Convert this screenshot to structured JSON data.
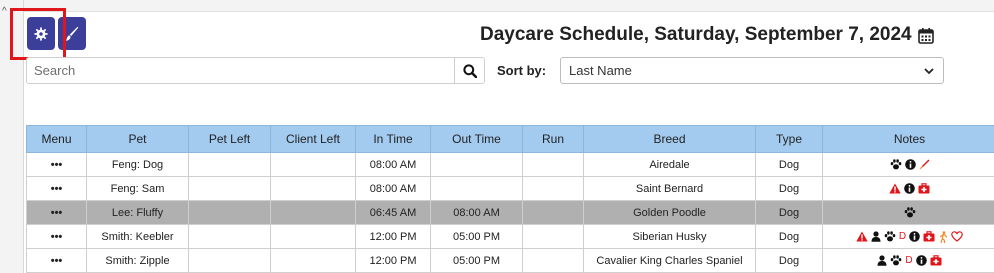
{
  "toolbar": {
    "settings_icon": "gear-icon",
    "brush_icon": "paint-brush-icon",
    "button_color": "#3b3f9a",
    "highlight_color": "#e0161b"
  },
  "header": {
    "title": "Daycare Schedule, Saturday, September 7, 2024",
    "calendar_icon": "calendar-icon"
  },
  "search": {
    "placeholder": "Search",
    "value": "",
    "icon": "search-icon"
  },
  "sort": {
    "label": "Sort by:",
    "selected": "Last Name"
  },
  "table": {
    "header_color": "#a3cbf0",
    "columns": [
      "Menu",
      "Pet",
      "Pet Left",
      "Client Left",
      "In Time",
      "Out Time",
      "Run",
      "Breed",
      "Type",
      "Notes"
    ],
    "rows": [
      {
        "menu": "•••",
        "pet": "Feng: Dog",
        "pet_left": "",
        "client_left": "",
        "in_time": "08:00 AM",
        "out_time": "",
        "run": "",
        "breed": "Airedale",
        "type": "Dog",
        "notes": [
          "paw-icon",
          "info-icon",
          "syringe-icon"
        ]
      },
      {
        "menu": "•••",
        "pet": "Feng: Sam",
        "pet_left": "",
        "client_left": "",
        "in_time": "08:00 AM",
        "out_time": "",
        "run": "",
        "breed": "Saint Bernard",
        "type": "Dog",
        "notes": [
          "warning-icon",
          "info-icon",
          "medkit-icon"
        ]
      },
      {
        "menu": "•••",
        "pet": "Lee: Fluffy",
        "pet_left": "",
        "client_left": "",
        "in_time": "06:45 AM",
        "out_time": "08:00 AM",
        "run": "",
        "breed": "Golden Poodle",
        "type": "Dog",
        "notes": [
          "paw-icon"
        ]
      },
      {
        "menu": "•••",
        "pet": "Smith: Keebler",
        "pet_left": "",
        "client_left": "",
        "in_time": "12:00 PM",
        "out_time": "05:00 PM",
        "run": "",
        "breed": "Siberian Husky",
        "type": "Dog",
        "notes": [
          "warning-icon",
          "user-icon",
          "paw-icon",
          "d-letter",
          "info-icon",
          "medkit-icon",
          "person-walking-icon",
          "heart-icon"
        ]
      },
      {
        "menu": "•••",
        "pet": "Smith: Zipple",
        "pet_left": "",
        "client_left": "",
        "in_time": "12:00 PM",
        "out_time": "05:00 PM",
        "run": "",
        "breed": "Cavalier King Charles Spaniel",
        "type": "Dog",
        "notes": [
          "user-icon",
          "paw-icon",
          "d-letter",
          "info-icon",
          "medkit-icon"
        ]
      }
    ],
    "notes_letter": "D"
  }
}
